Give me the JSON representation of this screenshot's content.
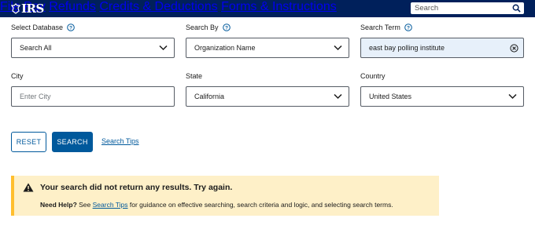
{
  "header": {
    "logo_text": "IRS",
    "nav": [
      "File",
      "Pay",
      "Refunds",
      "Credits & Deductions",
      "Forms & Instructions"
    ],
    "search_placeholder": "Search"
  },
  "form": {
    "select_database": {
      "label": "Select Database",
      "value": "Search All"
    },
    "search_by": {
      "label": "Search By",
      "value": "Organization Name"
    },
    "search_term": {
      "label": "Search Term",
      "value": "east bay polling institute"
    },
    "city": {
      "label": "City",
      "placeholder": "Enter City"
    },
    "state": {
      "label": "State",
      "value": "California"
    },
    "country": {
      "label": "Country",
      "value": "United States"
    }
  },
  "actions": {
    "reset_label": "RESET",
    "search_label": "SEARCH",
    "tips_label": "Search Tips"
  },
  "alert": {
    "heading": "Your search did not return any results. Try again.",
    "help_label": "Need Help?",
    "see_text": " See ",
    "tips_link": "Search Tips",
    "rest_text": " for guidance on effective searching, search criteria and logic, and selecting search terms."
  },
  "colors": {
    "header_bg": "#00205b",
    "primary": "#00599c",
    "alert_bg": "#fef0c8",
    "alert_border": "#ffbe2e",
    "term_bg": "#e7f0fa"
  }
}
